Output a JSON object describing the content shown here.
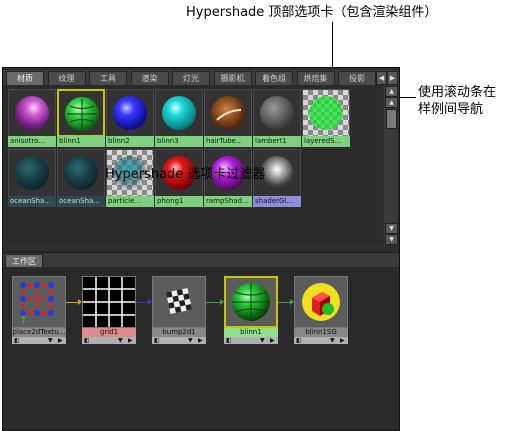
{
  "annotations": {
    "top_tabs": "Hypershade 顶部选项卡（包含渲染组件）",
    "scrollbar_line1": "使用滚动条在",
    "scrollbar_line2": "样例间导航",
    "filter": "Hypershade 选项卡过滤器"
  },
  "tabs": [
    {
      "label": "材质",
      "active": true
    },
    {
      "label": "纹理",
      "active": false
    },
    {
      "label": "工具",
      "active": false
    },
    {
      "label": "渲染",
      "active": false
    },
    {
      "label": "灯光",
      "active": false
    },
    {
      "label": "摄影机",
      "active": false
    },
    {
      "label": "着色组",
      "active": false
    },
    {
      "label": "烘焙集",
      "active": false
    },
    {
      "label": "投影",
      "active": false
    }
  ],
  "swatches": [
    {
      "label": "anisotro...",
      "kind": "aniso",
      "label_style": "green"
    },
    {
      "label": "blinn1",
      "kind": "blinn1",
      "label_style": "green"
    },
    {
      "label": "blinn2",
      "kind": "blue",
      "label_style": "green"
    },
    {
      "label": "blinn3",
      "kind": "cyan",
      "label_style": "green"
    },
    {
      "label": "hairTube...",
      "kind": "hair",
      "label_style": "green"
    },
    {
      "label": "lambert1",
      "kind": "grey",
      "label_style": "green"
    },
    {
      "label": "layeredS...",
      "kind": "layered",
      "label_style": "green"
    },
    {
      "label": "oceanSha...",
      "kind": "ocean",
      "label_style": "dark"
    },
    {
      "label": "oceanSha...",
      "kind": "ocean",
      "label_style": "dark"
    },
    {
      "label": "particle...",
      "kind": "particle",
      "label_style": "green"
    },
    {
      "label": "phong1",
      "kind": "red",
      "label_style": "green"
    },
    {
      "label": "rampShad...",
      "kind": "purple",
      "label_style": "green"
    },
    {
      "label": "shaderGl...",
      "kind": "glass",
      "label_style": "shader"
    }
  ],
  "work_tab": "工作区",
  "nodes": [
    {
      "label": "place2dTextu...",
      "kind": "place2d",
      "label_style": "grey"
    },
    {
      "label": "grid1",
      "kind": "grid",
      "label_style": "pink"
    },
    {
      "label": "bump2d1",
      "kind": "bump",
      "label_style": "grey"
    },
    {
      "label": "blinn1",
      "kind": "blinn",
      "label_style": "green"
    },
    {
      "label": "blinn1SG",
      "kind": "sg",
      "label_style": "grey"
    }
  ]
}
